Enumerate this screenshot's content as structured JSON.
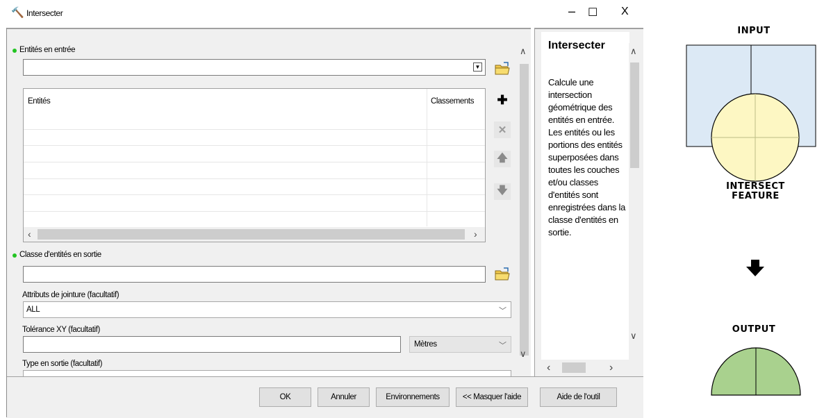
{
  "window": {
    "title": "Intersecter",
    "minimize": "–",
    "maximize": "☐",
    "close": "X"
  },
  "form": {
    "input_entities_label": "Entités en entrée",
    "input_entities_value": "",
    "table_headers": [
      "Entités",
      "Classements"
    ],
    "output_class_label": "Classe d'entités en sortie",
    "output_class_value": "",
    "join_attributes_label": "Attributs de jointure (facultatif)",
    "join_attributes_value": "ALL",
    "xy_tolerance_label": "Tolérance XY (facultatif)",
    "xy_tolerance_value": "",
    "xy_tolerance_unit": "Mètres",
    "output_type_label": "Type en sortie (facultatif)"
  },
  "help": {
    "title": "Intersecter",
    "text": "Calcule une intersection géométrique des entités en entrée. Les entités ou les portions des entités superposées dans toutes les couches et/ou classes d'entités sont enregistrées dans la classe d'entités en sortie."
  },
  "buttons": {
    "ok": "OK",
    "cancel": "Annuler",
    "environments": "Environnements",
    "hide_help": "<< Masquer l'aide",
    "tool_help": "Aide de l'outil"
  },
  "icons": {
    "window": "hammer-icon",
    "browse": "folder-icon",
    "add": "plus-icon",
    "remove": "x-icon",
    "up": "arrow-up-icon",
    "down": "arrow-down-icon"
  },
  "diagram": {
    "input_label": "INPUT",
    "intersect_label": "INTERSECT\nFEATURE",
    "output_label": "OUTPUT",
    "colors": {
      "input_fill": "#dce9f5",
      "circle_fill": "#fdf7c3",
      "output_fill": "#a9d18e"
    }
  }
}
